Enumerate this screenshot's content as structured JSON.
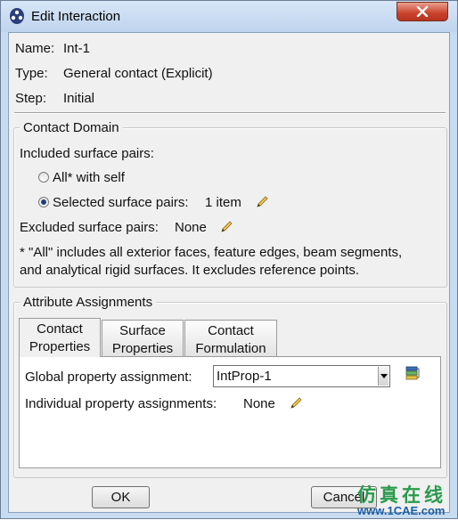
{
  "window": {
    "title": "Edit Interaction"
  },
  "info": {
    "name_label": "Name:",
    "name_value": "Int-1",
    "type_label": "Type:",
    "type_value": "General contact (Explicit)",
    "step_label": "Step:",
    "step_value": "Initial"
  },
  "contact_domain": {
    "title": "Contact Domain",
    "included_label": "Included surface pairs:",
    "option_all": "All* with self",
    "option_selected": "Selected surface pairs:",
    "selected_count": "1 item",
    "selected_option": "Selected surface pairs",
    "excluded_label": "Excluded surface pairs:",
    "excluded_value": "None",
    "note_line1": "* \"All\" includes all exterior faces, feature edges, beam segments,",
    "note_line2": "and analytical rigid surfaces. It excludes reference points."
  },
  "attributes": {
    "title": "Attribute Assignments",
    "tabs": [
      {
        "line1": "Contact",
        "line2": "Properties",
        "active": true
      },
      {
        "line1": "Surface",
        "line2": "Properties",
        "active": false
      },
      {
        "line1": "Contact",
        "line2": "Formulation",
        "active": false
      }
    ],
    "global_label": "Global property assignment:",
    "global_value": "IntProp-1",
    "individual_label": "Individual property assignments:",
    "individual_value": "None"
  },
  "buttons": {
    "ok": "OK",
    "cancel": "Cancel"
  },
  "watermark": {
    "text_cn": "仿真在线",
    "url": "www.1CAE.com"
  },
  "colors": {
    "title_bar": "#c7dbf1",
    "close_button": "#c9412a",
    "client_bg": "#f0f0f0"
  }
}
